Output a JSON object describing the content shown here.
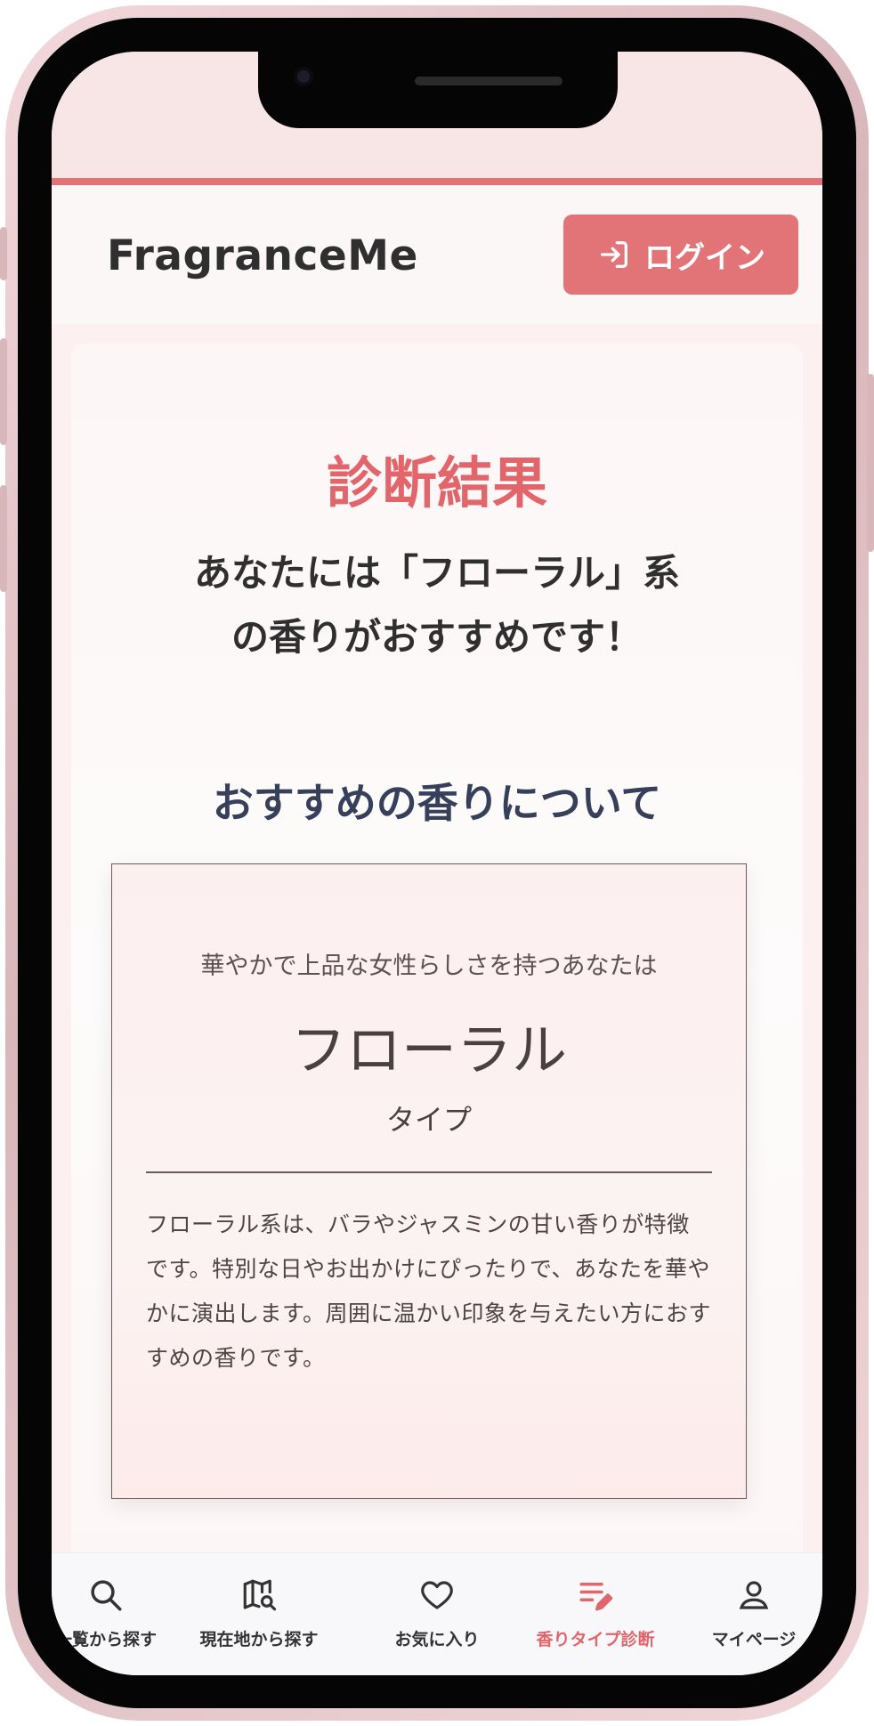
{
  "header": {
    "app_title": "FragranceMe",
    "login_label": "ログイン"
  },
  "result": {
    "heading": "診断結果",
    "message_line1": "あなたには「フローラル」系",
    "message_line2": "の香りがおすすめです！"
  },
  "recommendation": {
    "section_title": "おすすめの香りについて",
    "subtitle": "華やかで上品な女性らしさを持つあなたは",
    "type_name": "フローラル",
    "type_suffix": "タイプ",
    "description": "フローラル系は、バラやジャスミンの甘い香りが特徴です。特別な日やお出かけにぴったりで、あなたを華やかに演出します。周囲に温かい印象を与えたい方におすすめの香りです。"
  },
  "bottom_nav": {
    "items": [
      {
        "label": "一覧から探す",
        "icon": "search-icon"
      },
      {
        "label": "現在地から探す",
        "icon": "map-search-icon"
      },
      {
        "label": "お気に入り",
        "icon": "heart-icon"
      },
      {
        "label": "香りタイプ診断",
        "icon": "edit-list-icon",
        "active": true
      },
      {
        "label": "マイページ",
        "icon": "user-icon"
      }
    ]
  },
  "colors": {
    "accent": "#e27478",
    "heading_accent": "#e0666b",
    "section_title": "#36405a"
  }
}
